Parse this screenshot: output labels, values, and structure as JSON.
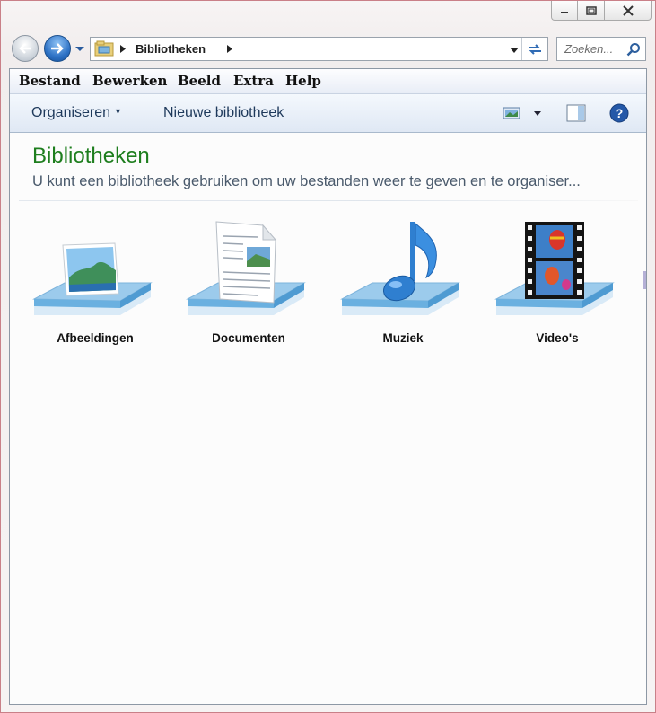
{
  "address": {
    "crumb": "Bibliotheken"
  },
  "search": {
    "placeholder": "Zoeken..."
  },
  "menu": [
    "Bestand",
    "Bewerken",
    "Beeld",
    "Extra",
    "Help"
  ],
  "toolbar": {
    "organize": "Organiseren",
    "new_library": "Nieuwe bibliotheek"
  },
  "content": {
    "title": "Bibliotheken",
    "subtitle": "U kunt een bibliotheek gebruiken om uw bestanden weer te geven en te organiser..."
  },
  "libraries": [
    {
      "label": "Afbeeldingen",
      "icon": "pictures-library-icon"
    },
    {
      "label": "Documenten",
      "icon": "documents-library-icon"
    },
    {
      "label": "Muziek",
      "icon": "music-library-icon"
    },
    {
      "label": "Video's",
      "icon": "videos-library-icon"
    }
  ],
  "colors": {
    "heading": "#1e7e1e",
    "command_text": "#1e395b",
    "window_border": "#c98088"
  }
}
